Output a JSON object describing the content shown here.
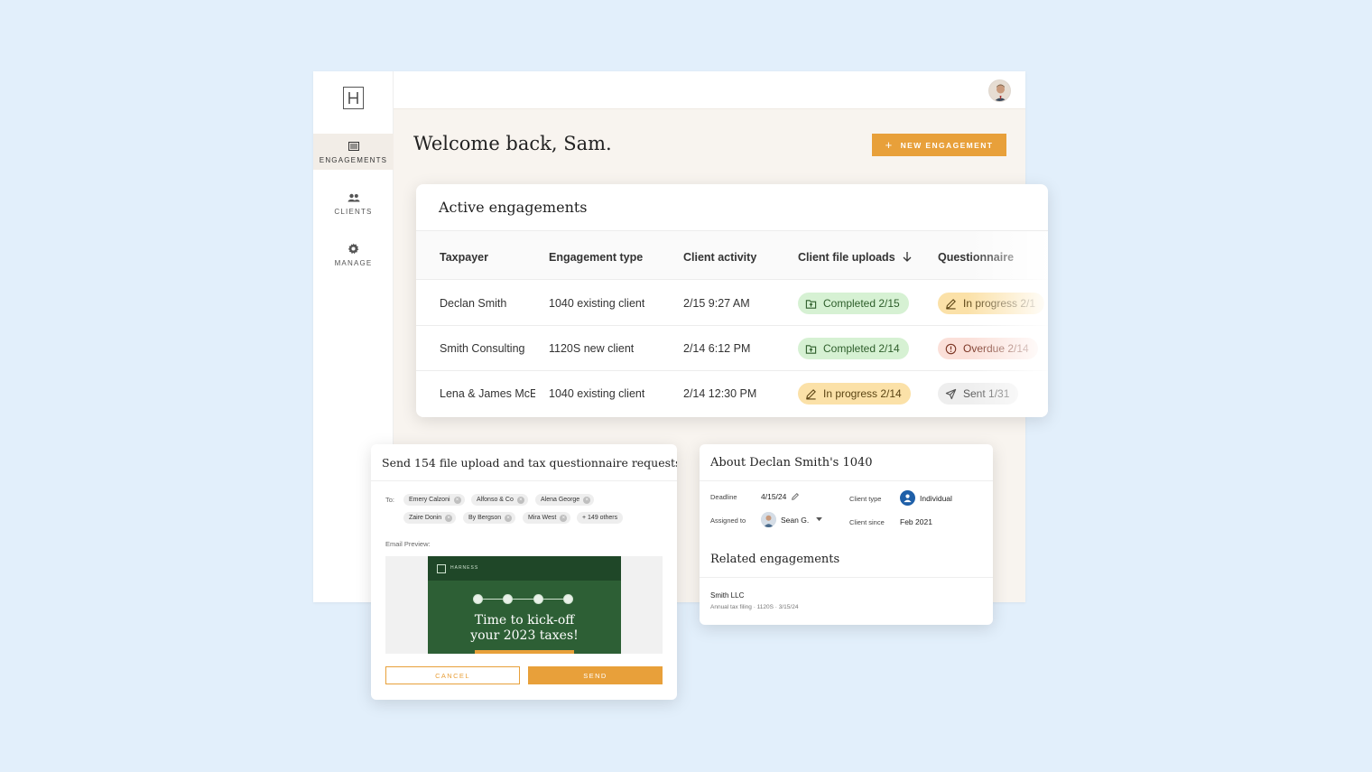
{
  "sidebar": {
    "items": [
      {
        "label": "ENGAGEMENTS",
        "icon": "list-icon",
        "active": true
      },
      {
        "label": "CLIENTS",
        "icon": "people-icon",
        "active": false
      },
      {
        "label": "MANAGE",
        "icon": "gear-icon",
        "active": false
      }
    ]
  },
  "header": {
    "welcome": "Welcome back, Sam.",
    "new_button": "NEW ENGAGEMENT",
    "new_button_icon": "plus-icon"
  },
  "engagements": {
    "title": "Active engagements",
    "columns": [
      "Taxpayer",
      "Engagement type",
      "Client activity",
      "Client file uploads",
      "Questionnaire"
    ],
    "sort_icon": "arrow-down-icon",
    "rows": [
      {
        "taxpayer": "Declan Smith",
        "type": "1040 existing client",
        "activity": "2/15 9:27 AM",
        "uploads": "Completed 2/15",
        "uploads_status": "completed",
        "questionnaire": "In progress 2/1",
        "q_status": "in-progress"
      },
      {
        "taxpayer": "Smith Consulting",
        "type": "1120S new client",
        "activity": "2/14 6:12 PM",
        "uploads": "Completed 2/14",
        "uploads_status": "completed",
        "questionnaire": "Overdue 2/14",
        "q_status": "overdue"
      },
      {
        "taxpayer": "Lena & James McE",
        "type": "1040 existing client",
        "activity": "2/14 12:30 PM",
        "uploads": "In progress 2/14",
        "uploads_status": "in-progress",
        "questionnaire": "Sent 1/31",
        "q_status": "sent"
      }
    ]
  },
  "send_requests": {
    "title": "Send 154 file upload and tax questionnaire requests",
    "to_label": "To:",
    "recipients_row1": [
      "Emery Calzoni",
      "Alfonso & Co",
      "Alena George"
    ],
    "recipients_row2": [
      "Zaire Donin",
      "By Bergson",
      "Mira West"
    ],
    "others": "+ 149 others",
    "preview_label": "Email Preview:",
    "email_brand": "HARNESS",
    "email_line1": "Time to kick-off",
    "email_line2": "your 2023 taxes!",
    "cancel": "CANCEL",
    "send": "SEND"
  },
  "about": {
    "title": "About Declan Smith's 1040",
    "deadline_label": "Deadline",
    "deadline": "4/15/24",
    "assigned_label": "Assigned to",
    "assigned": "Sean G.",
    "client_type_label": "Client type",
    "client_type": "Individual",
    "client_since_label": "Client since",
    "client_since": "Feb 2021",
    "related_title": "Related engagements",
    "related_name": "Smith LLC",
    "related_sub": "Annual tax filing · 1120S · 3/15/24"
  },
  "colors": {
    "accent": "#e8a03a",
    "background": "#e2effb",
    "email_green": "#2d5f35",
    "completed_bg": "#d6f1d3",
    "in_progress_bg": "#fbe1a8",
    "overdue_bg": "#fbe0d9"
  }
}
